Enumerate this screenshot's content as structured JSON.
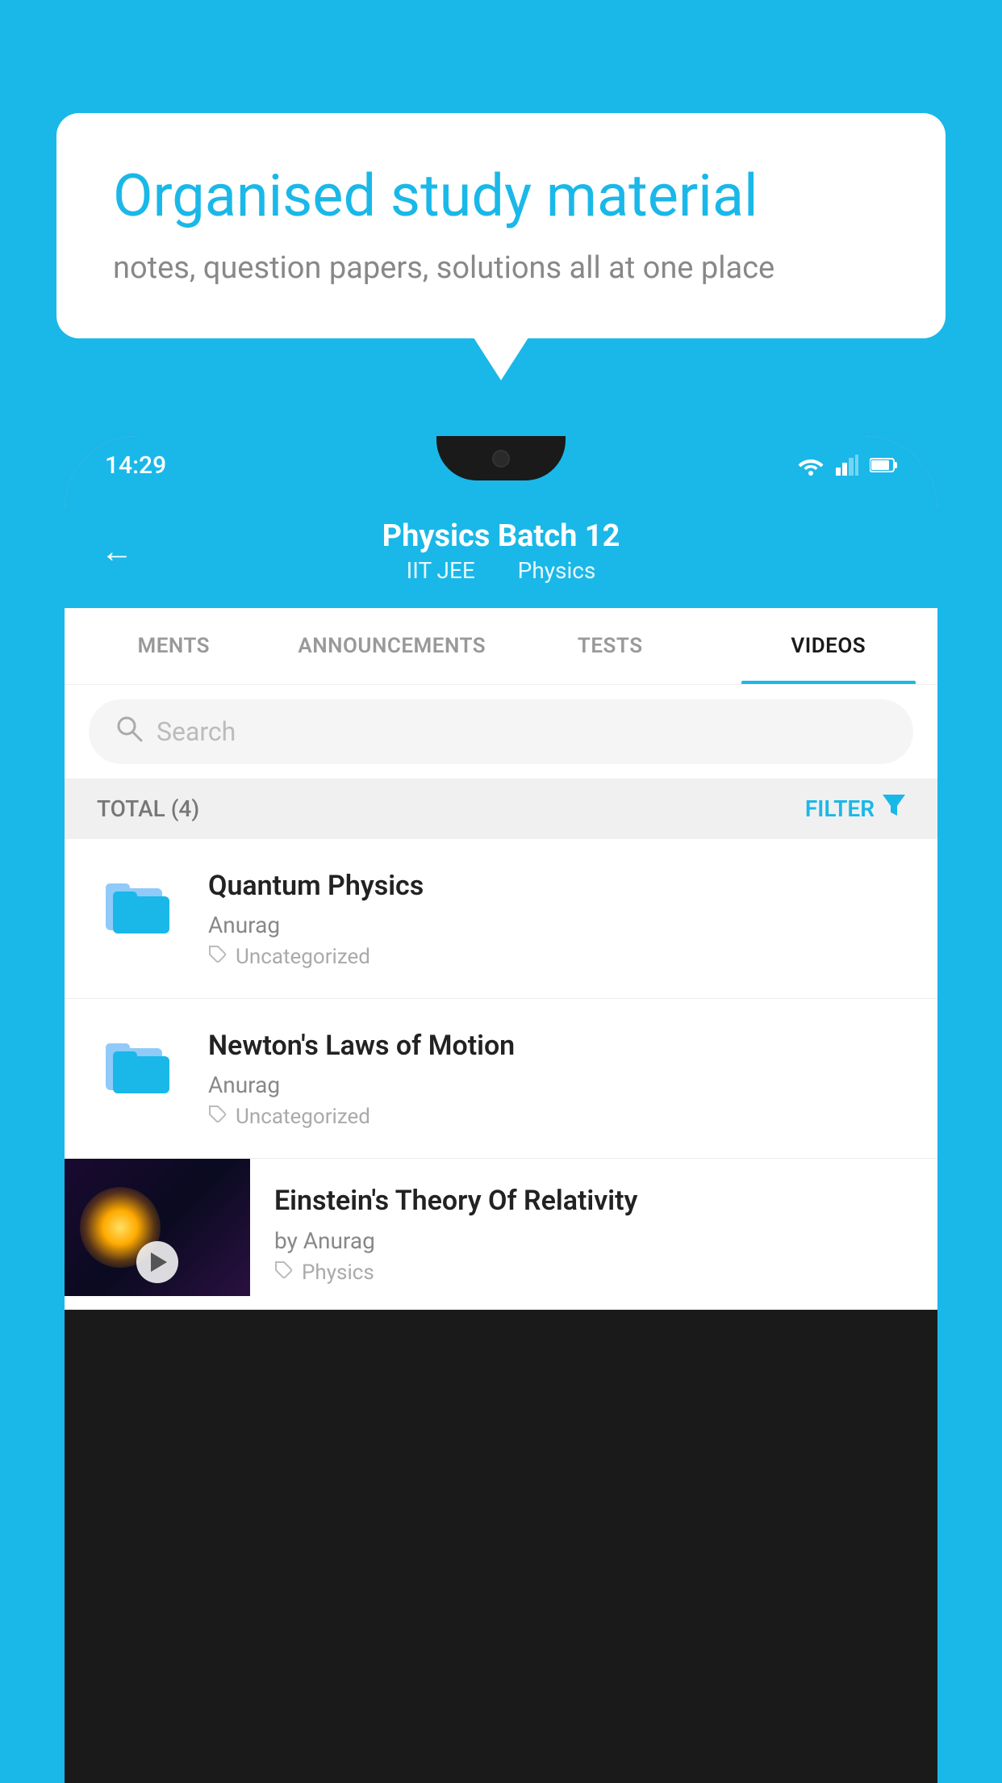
{
  "background_color": "#1ab8e8",
  "bubble": {
    "title": "Organised study material",
    "subtitle": "notes, question papers, solutions all at one place"
  },
  "phone": {
    "status_bar": {
      "time": "14:29"
    },
    "header": {
      "back_label": "←",
      "title": "Physics Batch 12",
      "subtitle_part1": "IIT JEE",
      "subtitle_part2": "Physics"
    },
    "tabs": [
      {
        "label": "MENTS",
        "active": false
      },
      {
        "label": "ANNOUNCEMENTS",
        "active": false
      },
      {
        "label": "TESTS",
        "active": false
      },
      {
        "label": "VIDEOS",
        "active": true
      }
    ],
    "search": {
      "placeholder": "Search"
    },
    "filter_row": {
      "total_label": "TOTAL (4)",
      "filter_label": "FILTER"
    },
    "videos": [
      {
        "title": "Quantum Physics",
        "author": "Anurag",
        "tag": "Uncategorized",
        "has_thumbnail": false
      },
      {
        "title": "Newton's Laws of Motion",
        "author": "Anurag",
        "tag": "Uncategorized",
        "has_thumbnail": false
      },
      {
        "title": "Einstein's Theory Of Relativity",
        "author": "by Anurag",
        "tag": "Physics",
        "has_thumbnail": true
      }
    ]
  }
}
